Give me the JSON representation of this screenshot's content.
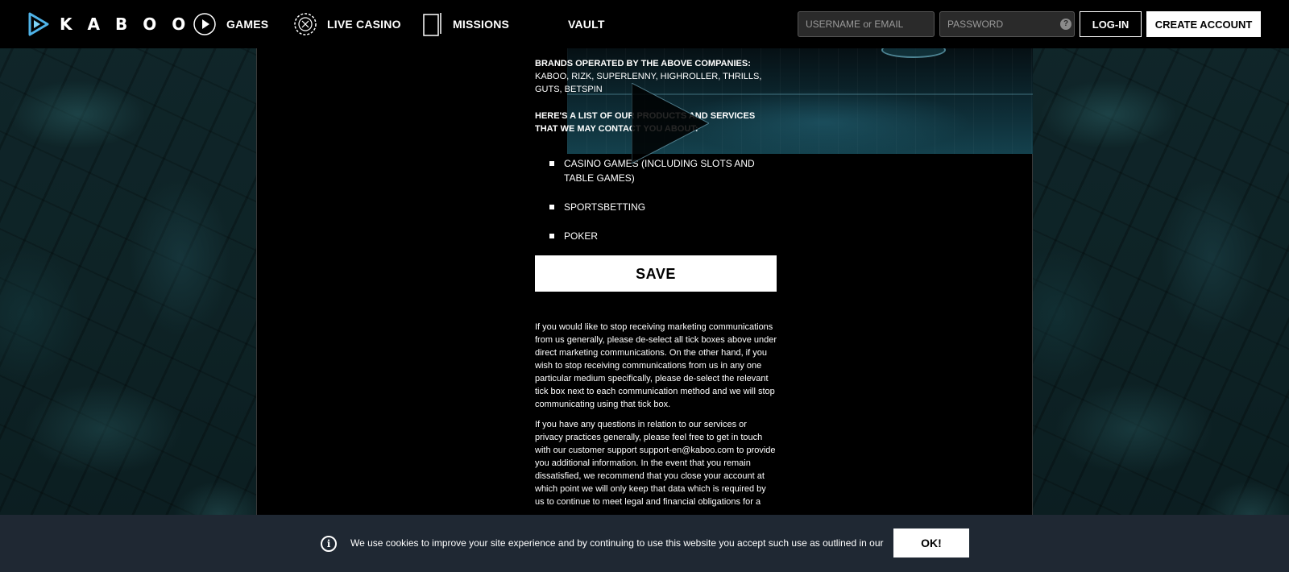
{
  "header": {
    "logo_text": "KABOO",
    "nav": [
      {
        "label": "GAMES",
        "icon": "play-circle-icon"
      },
      {
        "label": "LIVE CASINO",
        "icon": "roulette-chip-icon"
      },
      {
        "label": "MISSIONS",
        "icon": "mission-card-icon"
      },
      {
        "label": "VAULT",
        "icon": ""
      }
    ],
    "username_placeholder": "USERNAME or EMAIL",
    "password_placeholder": "PASSWORD",
    "help_symbol": "?",
    "login_label": "LOG-IN",
    "create_account_label": "CREATE ACCOUNT"
  },
  "content": {
    "brands_heading": "BRANDS OPERATED BY THE ABOVE COMPANIES:",
    "brands_list": "KABOO, RIZK, SUPERLENNY, HIGHROLLER, THRILLS, GUTS, BETSPIN",
    "list_intro": "HERE'S A LIST OF OUR PRODUCTS AND SERVICES THAT WE MAY CONTACT YOU ABOUT:",
    "services": [
      "CASINO GAMES (INCLUDING SLOTS AND TABLE GAMES)",
      "SPORTSBETTING",
      "POKER"
    ],
    "save_label": "SAVE",
    "paragraph_1": "If you would like to stop receiving marketing communications from us generally, please de-select all tick boxes above under direct marketing communications. On the other hand, if you wish to stop receiving communications from us in any one particular medium specifically, please de-select the relevant tick box next to each communication method and we will stop communicating using that tick box.",
    "paragraph_2": "If you have any questions in relation to our services or privacy practices generally, please feel free to get in touch with our customer support support-en@kaboo.com to provide you additional information. In the event that you remain dissatisfied, we recommend that you close your account at which point we will only keep that data which is required by us to continue to meet legal and financial obligations for a"
  },
  "cookie_bar": {
    "info_symbol": "i",
    "text": "We use cookies to improve your site experience and by continuing to use this website you accept such use as outlined in our",
    "ok_label": "OK!"
  },
  "colors": {
    "header_bg": "#000000",
    "cookie_bg": "#1f2833",
    "accent_logo": "#4fb3e8"
  }
}
